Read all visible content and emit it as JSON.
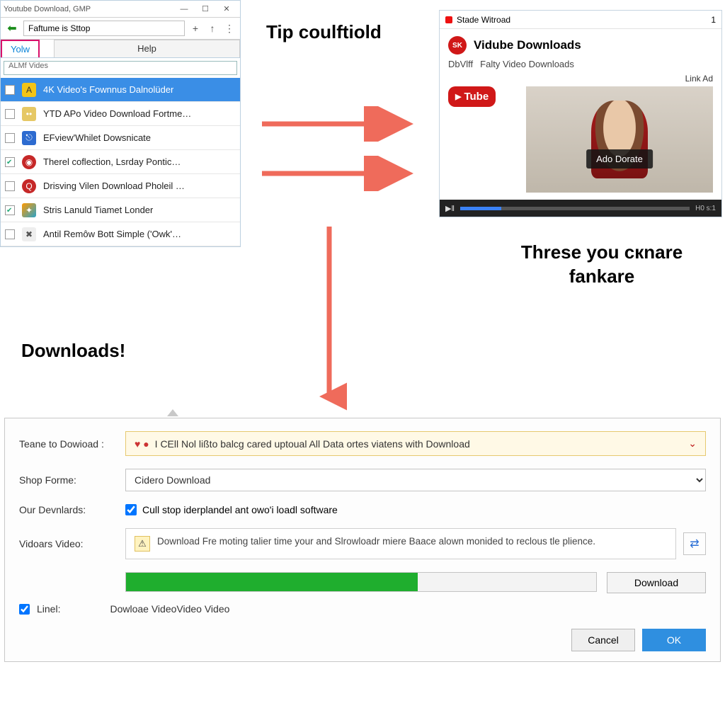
{
  "leftWindow": {
    "title": "Youtube Download, GMP",
    "winButtons": {
      "min": "—",
      "max": "☐",
      "close": "✕"
    },
    "addressValue": "Faftume is Sttop",
    "addBtn": "+",
    "upBtn": "↑",
    "menuBtn": "⋮",
    "tabs": {
      "active": "Yolw",
      "help": "Help"
    },
    "searchLabel": "ALMf Vides",
    "items": [
      {
        "label": "4K Video's Fownnus Dalnolüder",
        "selected": true,
        "checked": false
      },
      {
        "label": "YTD APo Video Download Fortme…",
        "selected": false,
        "checked": false
      },
      {
        "label": "EFview'Whilet Dowsnicate",
        "selected": false,
        "checked": false
      },
      {
        "label": "Therel coflection, Lsrday Pontic…",
        "selected": false,
        "checked": true
      },
      {
        "label": "Drisving Vilen Download Pholeil …",
        "selected": false,
        "checked": false
      },
      {
        "label": "Stris Lanuld Tiamet Londer",
        "selected": false,
        "checked": true
      },
      {
        "label": "Antil Remôw Bott Simple ('Owk'…",
        "selected": false,
        "checked": false
      }
    ]
  },
  "headings": {
    "tip": "Tip coulftiold",
    "downloads": "Downloads!",
    "threse": "Threse you cкnare fankare"
  },
  "card": {
    "windowTitle": "Stade Witroad",
    "windowNum": "1",
    "title": "Vidube Downloads",
    "subLeft": "DbVlff",
    "subRight": "Falty Video Downloads",
    "linkAd": "Link Ad",
    "tubeBadge": "Tube",
    "overlayBtn": "Ado Dorate",
    "playIcon": "▶ǁ",
    "time": "H0 s:1"
  },
  "dialog": {
    "labels": {
      "teane": "Teane to Dowioad :",
      "shop": "Shop Forme:",
      "our": "Our Devnlards:",
      "vids": "Vidoars Video:",
      "linel": "Linel:"
    },
    "warnText": "I CEll Nol lißto balcg cared uptoual All Data ortes viatens with Download",
    "warnIcons": "♥ ●",
    "selectValue": "Cidero Download",
    "checkboxLabel": "Cull stop iderplandel ant owo'i loadl software",
    "infoText": "Download Fre moting talier time your and Slrowloadr miere Baace alown monided to reclous tle plience.",
    "downloadBtn": "Download",
    "status": "Dowloae VideoVideo Video",
    "cancel": "Cancel",
    "ok": "OK"
  }
}
